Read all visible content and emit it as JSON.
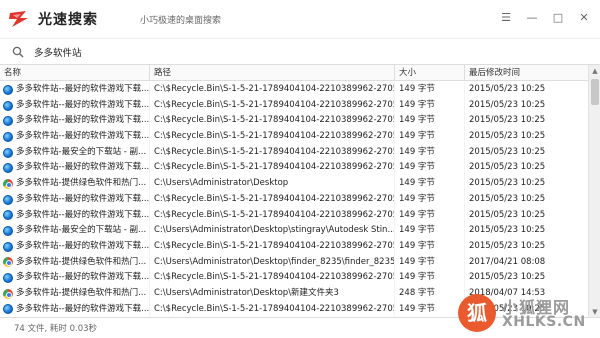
{
  "app": {
    "title": "光速搜索",
    "slogan": "小巧极速的桌面搜索"
  },
  "window_controls": {
    "menu": "☰",
    "minimize": "—",
    "maximize": "□",
    "close": "✕"
  },
  "search": {
    "value": "多多软件站",
    "placeholder": ""
  },
  "columns": {
    "name": "名称",
    "path": "路径",
    "size": "大小",
    "modified": "最后修改时间"
  },
  "rows": [
    {
      "icon": "ie-icon",
      "name": "多多软件站--最好的软件游戏下载...",
      "path": "C:\\$Recycle.Bin\\S-1-5-21-1789404104-2210389962-2705...",
      "size": "149 字节",
      "modified": "2015/05/23 10:25"
    },
    {
      "icon": "ie-icon",
      "name": "多多软件站--最好的软件游戏下载...",
      "path": "C:\\$Recycle.Bin\\S-1-5-21-1789404104-2210389962-2705...",
      "size": "149 字节",
      "modified": "2015/05/23 10:25"
    },
    {
      "icon": "ie-icon",
      "name": "多多软件站--最好的软件游戏下载...",
      "path": "C:\\$Recycle.Bin\\S-1-5-21-1789404104-2210389962-2705...",
      "size": "149 字节",
      "modified": "2015/05/23 10:25"
    },
    {
      "icon": "ie-icon",
      "name": "多多软件站--最好的软件游戏下载...",
      "path": "C:\\$Recycle.Bin\\S-1-5-21-1789404104-2210389962-2705...",
      "size": "149 字节",
      "modified": "2015/05/23 10:25"
    },
    {
      "icon": "ie-icon",
      "name": "多多软件站-最安全的下载站 - 副...",
      "path": "C:\\$Recycle.Bin\\S-1-5-21-1789404104-2210389962-2705...",
      "size": "149 字节",
      "modified": "2015/05/23 10:25"
    },
    {
      "icon": "ie-icon",
      "name": "多多软件站--最好的软件游戏下载...",
      "path": "C:\\$Recycle.Bin\\S-1-5-21-1789404104-2210389962-2705...",
      "size": "149 字节",
      "modified": "2015/05/23 10:25"
    },
    {
      "icon": "chrome-icon",
      "name": "多多软件站-提供绿色软件和热门...",
      "path": "C:\\Users\\Administrator\\Desktop",
      "size": "149 字节",
      "modified": "2015/05/23 10:25"
    },
    {
      "icon": "ie-icon",
      "name": "多多软件站--最好的软件游戏下载...",
      "path": "C:\\$Recycle.Bin\\S-1-5-21-1789404104-2210389962-2705...",
      "size": "149 字节",
      "modified": "2015/05/23 10:25"
    },
    {
      "icon": "ie-icon",
      "name": "多多软件站--最好的软件游戏下载...",
      "path": "C:\\$Recycle.Bin\\S-1-5-21-1789404104-2210389962-2705...",
      "size": "149 字节",
      "modified": "2015/05/23 10:25"
    },
    {
      "icon": "ie-icon",
      "name": "多多软件站-最安全的下载站 - 副...",
      "path": "C:\\Users\\Administrator\\Desktop\\stingray\\Autodesk Stin...",
      "size": "149 字节",
      "modified": "2015/05/23 10:25"
    },
    {
      "icon": "ie-icon",
      "name": "多多软件站--最好的软件游戏下载...",
      "path": "C:\\$Recycle.Bin\\S-1-5-21-1789404104-2210389962-2705...",
      "size": "149 字节",
      "modified": "2015/05/23 10:25"
    },
    {
      "icon": "chrome-icon",
      "name": "多多软件站-提供绿色软件和热门...",
      "path": "C:\\Users\\Administrator\\Desktop\\finder_8235\\finder_8235",
      "size": "149 字节",
      "modified": "2017/04/21 08:08"
    },
    {
      "icon": "ie-icon",
      "name": "多多软件站--最好的软件游戏下载...",
      "path": "C:\\$Recycle.Bin\\S-1-5-21-1789404104-2210389962-2705...",
      "size": "149 字节",
      "modified": "2015/05/23 10:25"
    },
    {
      "icon": "chrome-icon",
      "name": "多多软件站-提供绿色软件和热门...",
      "path": "C:\\Users\\Administrator\\Desktop\\新建文件夹3",
      "size": "248 字节",
      "modified": "2018/04/07 14:53"
    },
    {
      "icon": "ie-icon",
      "name": "多多软件站--最好的软件游戏下载...",
      "path": "C:\\$Recycle.Bin\\S-1-5-21-1789404104-2210389962-2705...",
      "size": "149 字节",
      "modified": "2015/05/23 10:25"
    }
  ],
  "status": {
    "text": "74 文件, 耗时 0.03秒"
  },
  "watermark": {
    "glyph": "狐",
    "line1": "小狐狸网",
    "line2": "XHLKS.CN"
  },
  "colors": {
    "accent_red": "#e0352b",
    "watermark_orange": "#e95b2e"
  }
}
